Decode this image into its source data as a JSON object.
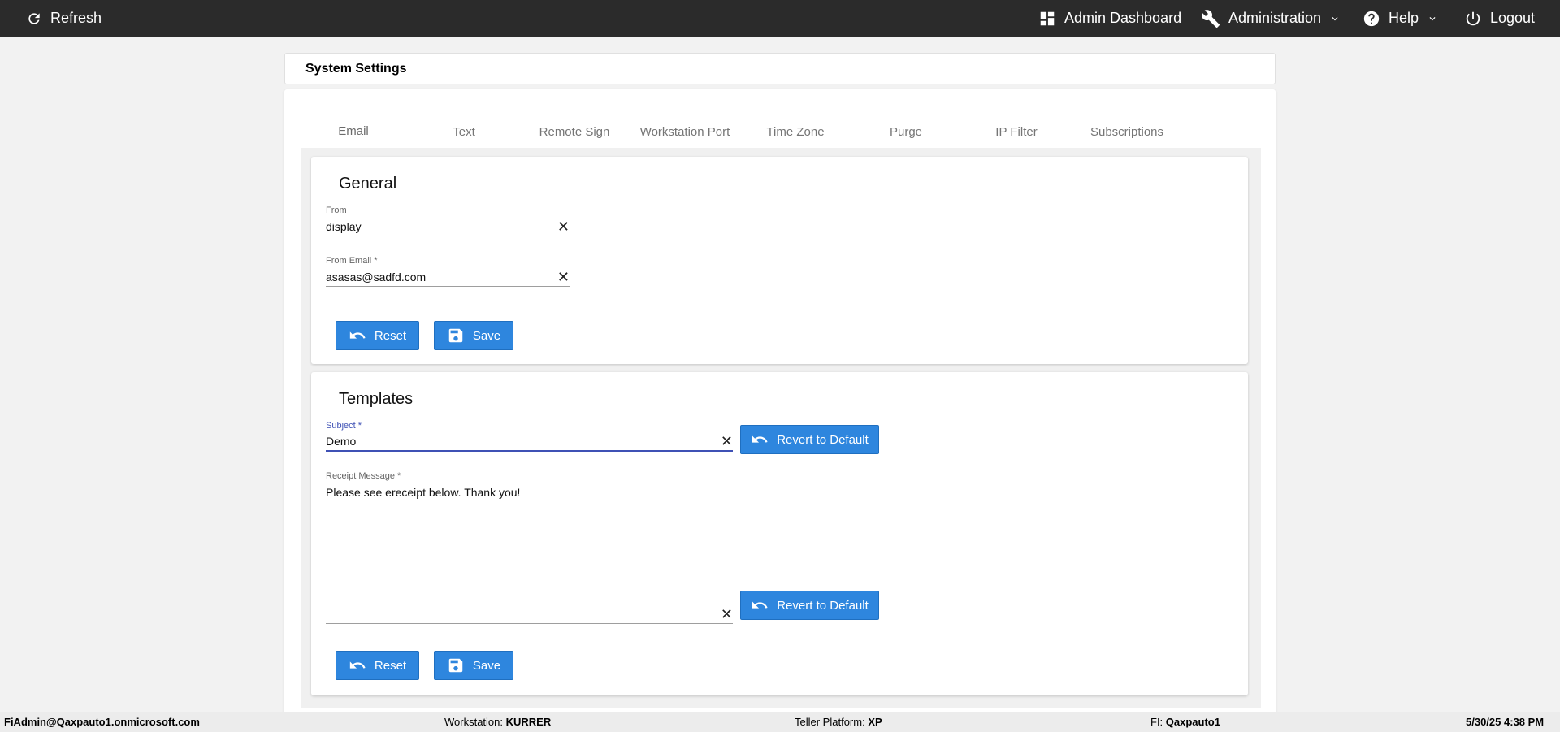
{
  "topbar": {
    "refresh": "Refresh",
    "admin_dashboard": "Admin Dashboard",
    "administration": "Administration",
    "help": "Help",
    "logout": "Logout"
  },
  "page_title": "System Settings",
  "tabs": [
    "Email",
    "Text",
    "Remote Sign",
    "Workstation Port",
    "Time Zone",
    "Purge",
    "IP Filter",
    "Subscriptions"
  ],
  "active_tab": "Email",
  "general": {
    "heading": "General",
    "from_label": "From",
    "from_value": "display",
    "from_email_label": "From Email *",
    "from_email_value": "asasas@sadfd.com",
    "reset": "Reset",
    "save": "Save"
  },
  "templates": {
    "heading": "Templates",
    "subject_label": "Subject *",
    "subject_value": "Demo",
    "revert": "Revert to Default",
    "receipt_label": "Receipt Message *",
    "receipt_value": "Please see ereceipt below. Thank you!",
    "reset": "Reset",
    "save": "Save"
  },
  "footer": {
    "user": "FiAdmin@Qaxpauto1.onmicrosoft.com",
    "workstation_label": "Workstation: ",
    "workstation_value": "KURRER",
    "platform_label": "Teller Platform: ",
    "platform_value": "XP",
    "fi_label": "FI: ",
    "fi_value": "Qaxpauto1",
    "datetime": "5/30/25 4:38 PM"
  }
}
